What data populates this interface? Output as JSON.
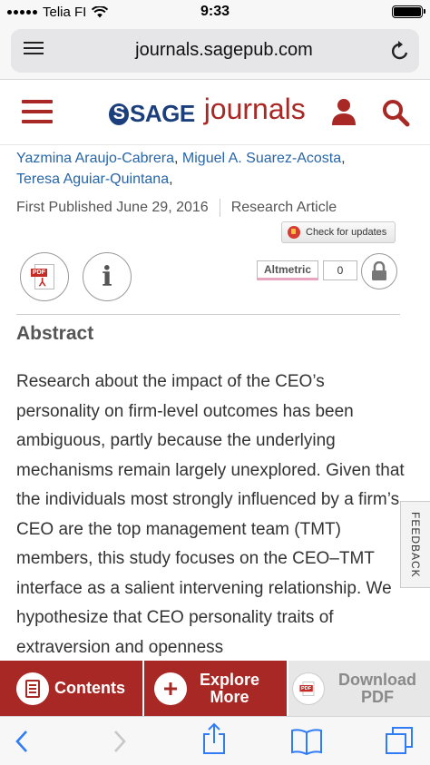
{
  "status_bar": {
    "carrier": "Telia FI",
    "time": "9:33"
  },
  "browser": {
    "url": "journals.sagepub.com"
  },
  "site": {
    "logo_sage": "SAGE",
    "logo_journals": "journals"
  },
  "article": {
    "authors": [
      "Yazmina Araujo-Cabrera",
      "Miguel A. Suarez-Acosta",
      "Teresa Aguiar-Quintana"
    ],
    "first_published": "First Published June 29, 2016",
    "article_type": "Research Article",
    "check_updates": "Check for updates",
    "altmetric_label": "Altmetric",
    "altmetric_score": "0",
    "abstract_heading": "Abstract",
    "abstract_text": "Research about the impact of the CEO’s personality on firm-level outcomes has been ambiguous, partly because the underlying mechanisms remain largely unexplored. Given that the individuals most strongly influenced by a firm’s CEO are the top management team (TMT) members, this study focuses on the CEO–TMT interface as a salient intervening relationship. We hypothesize that CEO personality traits of extraversion and openness"
  },
  "feedback_label": "FEEDBACK",
  "action_bar": {
    "contents": "Contents",
    "explore": "Explore More",
    "download": "Download PDF"
  },
  "colors": {
    "brand_red": "#a72824",
    "link_blue": "#2866a8",
    "sage_blue": "#1b3f7c"
  },
  "icons": [
    "reader-icon",
    "reload-icon",
    "menu-icon",
    "user-icon",
    "search-icon",
    "pdf-icon",
    "info-icon",
    "lock-icon",
    "back-icon",
    "forward-icon",
    "share-icon",
    "bookmarks-icon",
    "tabs-icon"
  ]
}
